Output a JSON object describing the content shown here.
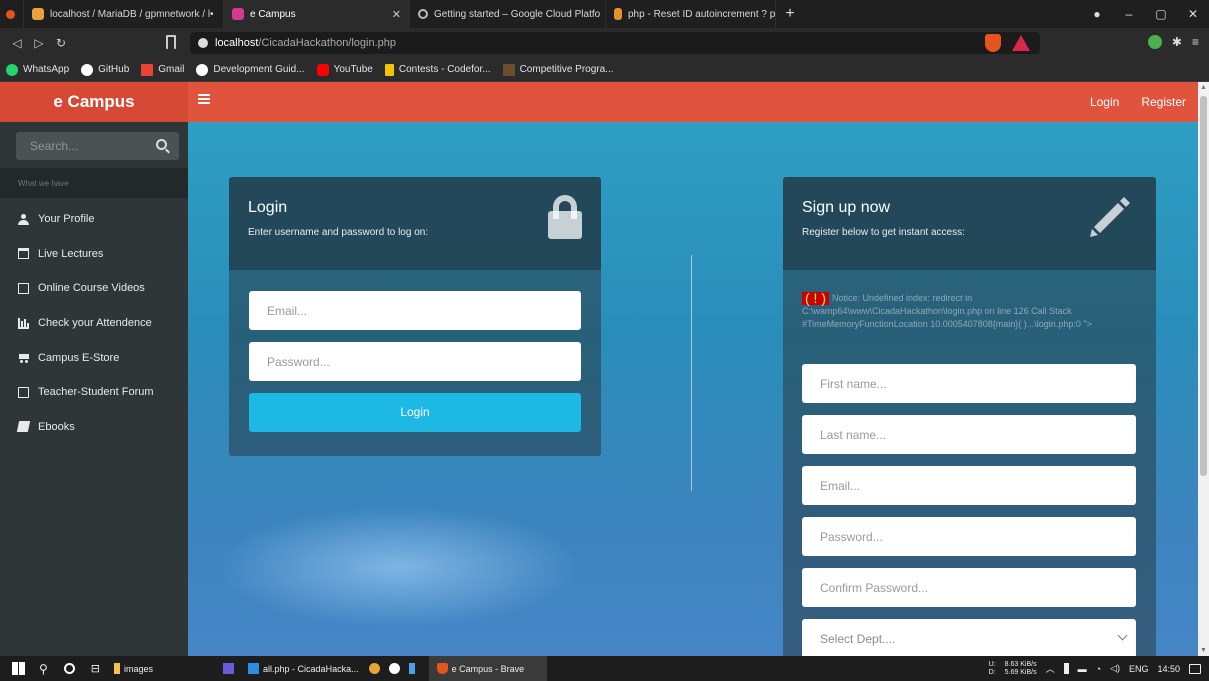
{
  "browser": {
    "tabs": [
      {
        "label": "localhost / MariaDB / gpmnetwork / l•",
        "active": false
      },
      {
        "label": "e Campus",
        "active": true
      },
      {
        "label": "Getting started – Google Cloud Platfo",
        "active": false
      },
      {
        "label": "php - Reset ID autoincrement ? phpm",
        "active": false
      }
    ],
    "url_host": "localhost",
    "url_path": "/CicadaHackathon/login.php",
    "bookmarks": [
      "WhatsApp",
      "GitHub",
      "Gmail",
      "Development Guid...",
      "YouTube",
      "Contests - Codefor...",
      "Competitive Progra..."
    ]
  },
  "header": {
    "brand": "e Campus",
    "login": "Login",
    "register": "Register"
  },
  "sidebar": {
    "search_placeholder": "Search...",
    "section_label": "What we have",
    "items": [
      {
        "label": "Your Profile",
        "icon": "user-icon"
      },
      {
        "label": "Live Lectures",
        "icon": "calendar-icon"
      },
      {
        "label": "Online Course Videos",
        "icon": "video-icon"
      },
      {
        "label": "Check your Attendence",
        "icon": "bar-chart-icon"
      },
      {
        "label": "Campus E-Store",
        "icon": "cart-icon"
      },
      {
        "label": "Teacher-Student Forum",
        "icon": "forum-icon"
      },
      {
        "label": "Ebooks",
        "icon": "book-icon"
      }
    ]
  },
  "login": {
    "title": "Login",
    "subtitle": "Enter username and password to log on:",
    "email_placeholder": "Email...",
    "password_placeholder": "Password...",
    "button": "Login"
  },
  "signup": {
    "title": "Sign up now",
    "subtitle": "Register below to get instant access:",
    "notice_bang": "( ! )",
    "notice_text": "Notice: Undefined index: redirect in C:\\wamp64\\www\\CicadaHackathon\\login.php on line 126 Call Stack #TimeMemoryFunctionLocation 10.0005407808{main}( )...\\login.php:0 \">",
    "first_name_placeholder": "First name...",
    "last_name_placeholder": "Last name...",
    "email_placeholder": "Email...",
    "password_placeholder": "Password...",
    "confirm_password_placeholder": "Confirm Password...",
    "dept_placeholder": "Select Dept...."
  },
  "taskbar": {
    "items": [
      "images",
      "all.php - CicadaHacka...",
      "e Campus - Brave"
    ],
    "net_up": "8.63 KiB/s",
    "net_down": "5.69 KiB/s",
    "net_up_label": "U:",
    "net_down_label": "D:",
    "lang": "ENG",
    "time": "14:50"
  },
  "colors": {
    "accent": "#e0533d",
    "button": "#1eb8e4",
    "sidebar": "#2f3637"
  }
}
